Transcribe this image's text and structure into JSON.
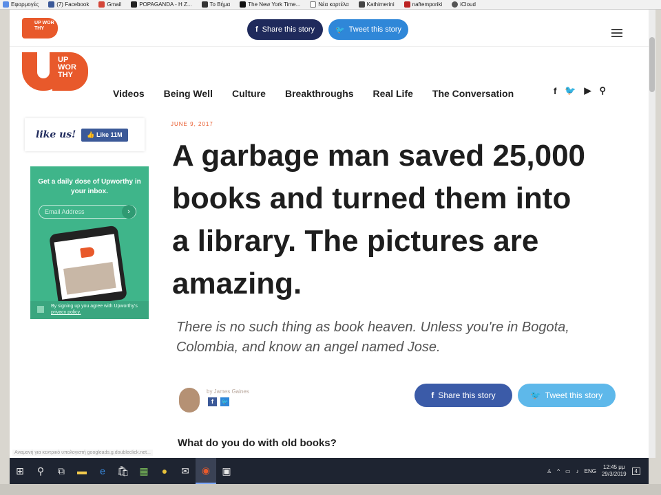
{
  "bookmarks": [
    {
      "label": "Εφαρμογές",
      "icon": "apps-grid-icon"
    },
    {
      "label": "(7) Facebook",
      "icon": "facebook-icon"
    },
    {
      "label": "Gmail",
      "icon": "gmail-icon"
    },
    {
      "label": "POPAGANDA - Η Ζ...",
      "icon": "bookmark-icon"
    },
    {
      "label": "Το Βήμα",
      "icon": "bookmark-icon"
    },
    {
      "label": "The New York Time...",
      "icon": "nyt-icon"
    },
    {
      "label": "Νέα καρτέλα",
      "icon": "page-icon"
    },
    {
      "label": "Kathimerini",
      "icon": "bookmark-icon"
    },
    {
      "label": "naftemporiki",
      "icon": "bookmark-icon"
    },
    {
      "label": "iCloud",
      "icon": "apple-icon"
    }
  ],
  "sharebar": {
    "logo_text": "UP WOR THY",
    "share_label": "Share this story",
    "tweet_label": "Tweet this story"
  },
  "nav": {
    "logo_text": "UP WOR THY",
    "links": [
      "Videos",
      "Being Well",
      "Culture",
      "Breakthroughs",
      "Real Life",
      "The Conversation"
    ]
  },
  "sidebar": {
    "like_us": "like us!",
    "like_button": "Like 11M",
    "newsletter_title": "Get a daily dose of Upworthy in your inbox.",
    "email_placeholder": "Email Address",
    "legal_prefix": "By signing up you agree with Upworthy's ",
    "legal_link": "privacy policy."
  },
  "article": {
    "date": "JUNE 9, 2017",
    "headline": "A garbage man saved 25,000 books and turned them into a library. The pictures are amazing.",
    "dek": "There is no such thing as book heaven. Unless you're in Bogota, Colombia, and know an angel named Jose.",
    "author_by": "by James Gaines",
    "share_label": "Share this story",
    "tweet_label": "Tweet this story",
    "subhead": "What do you do with old books?"
  },
  "browser_status": "Αναμονή για κεντρικό υπολογιστή googleads.g.doubleclick.net...",
  "taskbar": {
    "language": "ENG",
    "time": "12:45 μμ",
    "date": "29/3/2019",
    "notifications": "4"
  },
  "colors": {
    "brand_orange": "#e8592b",
    "facebook_blue": "#3b5998",
    "twitter_blue": "#2f87d8",
    "newsletter_green": "#3fb58a"
  }
}
